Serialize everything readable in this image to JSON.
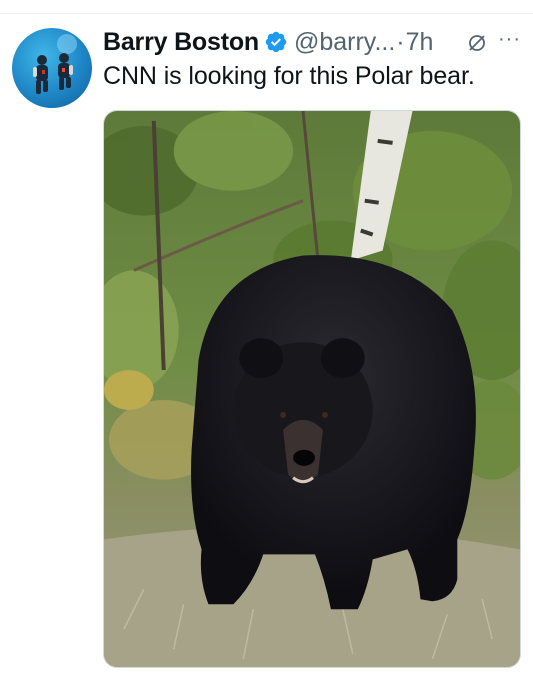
{
  "tweet": {
    "author_name": "Barry Boston",
    "handle": "@barry...",
    "separator": "·",
    "time": "7h",
    "text": "CNN is looking for this Polar bear.",
    "more_glyph": "···"
  },
  "icons": {
    "verified": "verified-badge-icon",
    "grok": "grok-icon",
    "more": "more-options-icon"
  },
  "colors": {
    "verified_blue": "#1d9bf0",
    "text_primary": "#0f1419",
    "text_secondary": "#536471"
  }
}
